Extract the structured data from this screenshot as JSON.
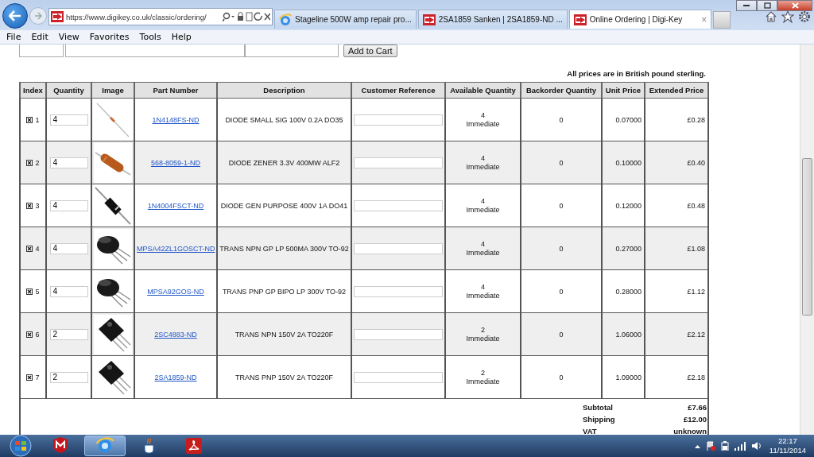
{
  "browser": {
    "url": "https://www.digikey.co.uk/classic/ordering/",
    "tabs": [
      {
        "kind": "ie-page",
        "title": "Stageline 500W amp repair pro...",
        "selected": false
      },
      {
        "kind": "shop-page",
        "title": "2SA1859 Sanken | 2SA1859-ND ...",
        "selected": false
      },
      {
        "kind": "shop-page",
        "title": "Online Ordering | Digi-Key",
        "selected": true
      }
    ],
    "close_tab": "×",
    "menu": [
      "File",
      "Edit",
      "View",
      "Favorites",
      "Tools",
      "Help"
    ]
  },
  "page": {
    "add_button": "Add to Cart",
    "currency_note": "All prices are in British pound sterling.",
    "table": {
      "columns": [
        "Index",
        "Quantity",
        "Image",
        "Part Number",
        "Description",
        "Customer Reference",
        "Available Quantity",
        "Backorder Quantity",
        "Unit Price",
        "Extended Price"
      ],
      "rows": [
        {
          "checked": true,
          "index": "1",
          "quantity": "4",
          "kind": "glass-diode",
          "part_number": "1N4148FS-ND",
          "description": "DIODE SMALL SIG 100V 0.2A DO35",
          "available": "4",
          "availability": "Immediate",
          "backorder": "0",
          "unit_price": "0.07000",
          "extended_price": "£0.28"
        },
        {
          "checked": true,
          "index": "2",
          "quantity": "4",
          "kind": "zener-diode",
          "part_number": "568-8059-1-ND",
          "description": "DIODE ZENER 3.3V 400MW ALF2",
          "available": "4",
          "availability": "Immediate",
          "backorder": "0",
          "unit_price": "0.10000",
          "extended_price": "£0.40"
        },
        {
          "checked": true,
          "index": "3",
          "quantity": "4",
          "kind": "axial-diode",
          "part_number": "1N4004FSCT-ND",
          "description": "DIODE GEN PURPOSE 400V 1A DO41",
          "available": "4",
          "availability": "Immediate",
          "backorder": "0",
          "unit_price": "0.12000",
          "extended_price": "£0.48"
        },
        {
          "checked": true,
          "index": "4",
          "quantity": "4",
          "kind": "to92",
          "part_number": "MPSA42ZL1GOSCT-ND",
          "description": "TRANS NPN GP LP 500MA 300V TO-92",
          "available": "4",
          "availability": "Immediate",
          "backorder": "0",
          "unit_price": "0.27000",
          "extended_price": "£1.08"
        },
        {
          "checked": true,
          "index": "5",
          "quantity": "4",
          "kind": "to92",
          "part_number": "MPSA92GOS-ND",
          "description": "TRANS PNP GP BIPO LP 300V TO-92",
          "available": "4",
          "availability": "Immediate",
          "backorder": "0",
          "unit_price": "0.28000",
          "extended_price": "£1.12"
        },
        {
          "checked": true,
          "index": "6",
          "quantity": "2",
          "kind": "to220",
          "part_number": "2SC4883-ND",
          "description": "TRANS NPN 150V 2A TO220F",
          "available": "2",
          "availability": "Immediate",
          "backorder": "0",
          "unit_price": "1.06000",
          "extended_price": "£2.12"
        },
        {
          "checked": true,
          "index": "7",
          "quantity": "2",
          "kind": "to220",
          "part_number": "2SA1859-ND",
          "description": "TRANS PNP 150V 2A TO220F",
          "available": "2",
          "availability": "Immediate",
          "backorder": "0",
          "unit_price": "1.09000",
          "extended_price": "£2.18"
        }
      ]
    },
    "totals": [
      {
        "label": "Subtotal",
        "value": "£7.66"
      },
      {
        "label": "Shipping",
        "value": "£12.00"
      },
      {
        "label": "VAT",
        "value": "unknown"
      }
    ]
  },
  "taskbar": {
    "apps": [
      {
        "kind": "shield"
      },
      {
        "kind": "browser",
        "selected": true
      },
      {
        "kind": "java"
      },
      {
        "kind": "pdf"
      }
    ],
    "time": "22:17",
    "date": "11/11/2014"
  }
}
